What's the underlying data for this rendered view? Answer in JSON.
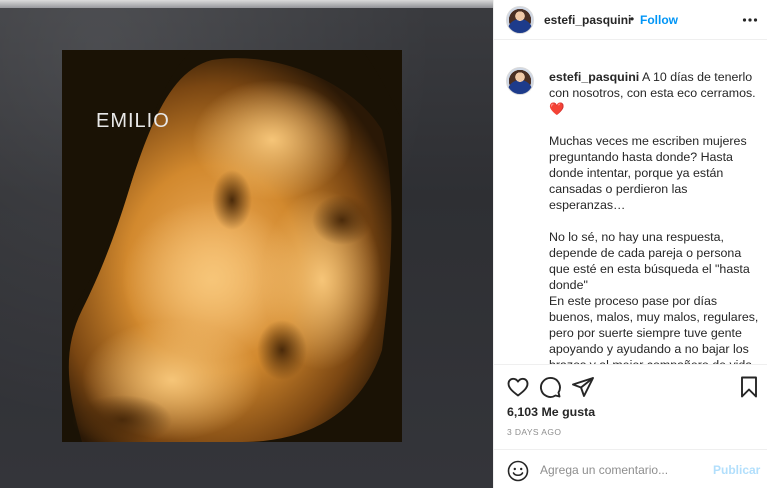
{
  "photo": {
    "overlay_text": "EMILIO",
    "description_colors": {
      "background": "#2e2f33",
      "scan_tone": "#d58a2c"
    }
  },
  "header": {
    "username": "estefi_pasquini",
    "separator": "•",
    "follow_label": "Follow",
    "more_icon": "more-horizontal-icon"
  },
  "caption": {
    "username": "estefi_pasquini",
    "paragraphs": [
      "A 10 días de tenerlo con nosotros, con esta eco cerramos.",
      "Muchas veces me escriben mujeres preguntando hasta donde? Hasta donde intentar, porque ya están cansadas o perdieron las esperanzas…",
      "No lo sé, no hay una respuesta, depende de cada pareja o persona que esté en esta búsqueda el \"hasta donde\"",
      "En este proceso pase por días buenos, malos, muy malos, regulares, pero por suerte siempre tuve gente apoyando y ayudando a no bajar los brazos y al mejor compañero de vida que pude encontrar, el cual me recordaba \"apretá los dientes y para atrás solo para tomar"
    ],
    "heart": "❤️"
  },
  "actions": {
    "like_icon": "heart-outline-icon",
    "comment_icon": "comment-icon",
    "share_icon": "paper-plane-icon",
    "save_icon": "bookmark-icon"
  },
  "likes": "6,103 Me gusta",
  "timestamp": "3 DAYS AGO",
  "comment": {
    "emoji_icon": "smiley-icon",
    "placeholder": "Agrega un comentario...",
    "publish_label": "Publicar"
  },
  "colors": {
    "link_blue": "#0095f6",
    "publish_disabled": "#b2dffc",
    "heart_red": "#ed4956",
    "secondary_text": "#8e8e8e"
  }
}
